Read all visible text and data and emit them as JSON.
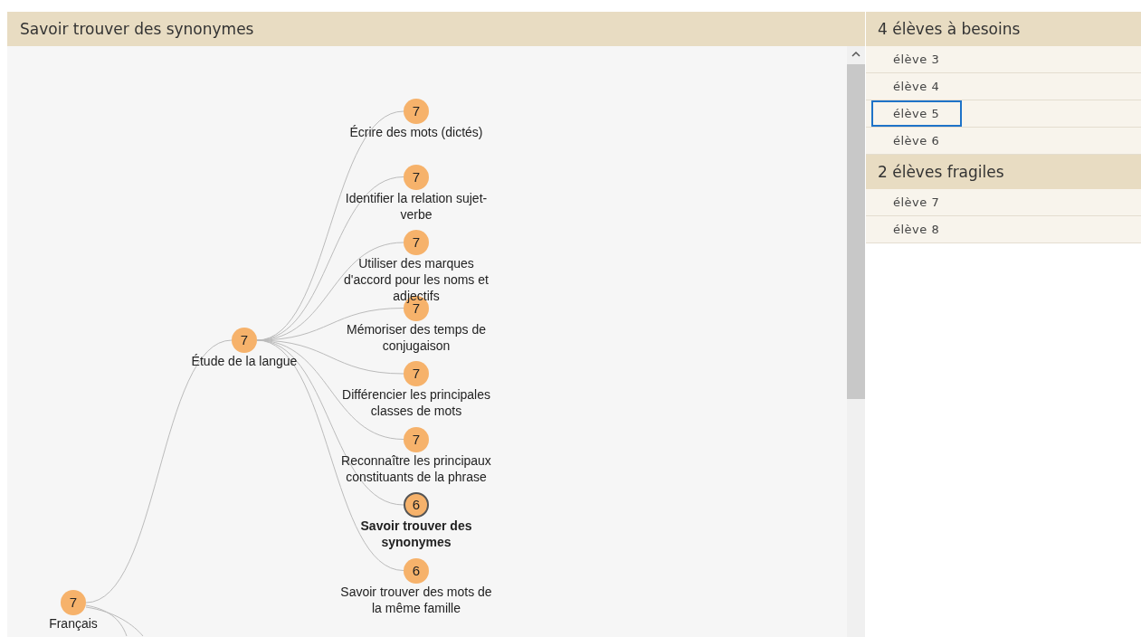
{
  "main_panel": {
    "title": "Savoir trouver des synonymes"
  },
  "tree": {
    "label": "Français",
    "count": "7",
    "selected": false,
    "children": [
      {
        "label": "Étude de la langue",
        "count": "7",
        "selected": false,
        "children": [
          {
            "label": "Écrire des mots (dictés)",
            "count": "7",
            "selected": false
          },
          {
            "label": "Identifier la relation sujet-verbe",
            "count": "7",
            "selected": false
          },
          {
            "label": "Utiliser des marques d'accord pour les noms et adjectifs",
            "count": "7",
            "selected": false
          },
          {
            "label": "Mémoriser des temps de conjugaison",
            "count": "7",
            "selected": false
          },
          {
            "label": "Différencier les principales classes de mots",
            "count": "7",
            "selected": false
          },
          {
            "label": "Reconnaître les principaux constituants de la phrase",
            "count": "7",
            "selected": false
          },
          {
            "label": "Savoir trouver des synonymes",
            "count": "6",
            "selected": true
          },
          {
            "label": "Savoir trouver des mots de la même famille",
            "count": "6",
            "selected": false
          }
        ]
      }
    ]
  },
  "groups": [
    {
      "title": "4 élèves à besoins",
      "students": [
        {
          "name": "élève 3",
          "selected": false
        },
        {
          "name": "élève 4",
          "selected": false
        },
        {
          "name": "élève 5",
          "selected": true
        },
        {
          "name": "élève 6",
          "selected": false
        }
      ]
    },
    {
      "title": "2 élèves fragiles",
      "students": [
        {
          "name": "élève 7",
          "selected": false
        },
        {
          "name": "élève 8",
          "selected": false
        }
      ]
    }
  ]
}
